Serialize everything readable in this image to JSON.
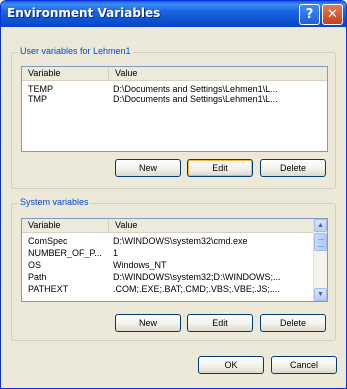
{
  "window": {
    "title": "Environment Variables",
    "help_glyph": "?",
    "close_glyph": "✕"
  },
  "user_vars": {
    "legend": "User variables for Lehmen1",
    "columns": [
      "Variable",
      "Value"
    ],
    "rows": [
      {
        "variable": "TEMP",
        "value": "D:\\Documents and Settings\\Lehmen1\\L..."
      },
      {
        "variable": "TMP",
        "value": "D:\\Documents and Settings\\Lehmen1\\L..."
      }
    ],
    "buttons": {
      "new": "New",
      "edit": "Edit",
      "delete": "Delete"
    }
  },
  "system_vars": {
    "legend": "System variables",
    "columns": [
      "Variable",
      "Value"
    ],
    "rows": [
      {
        "variable": "ComSpec",
        "value": "D:\\WINDOWS\\system32\\cmd.exe"
      },
      {
        "variable": "NUMBER_OF_P...",
        "value": "1"
      },
      {
        "variable": "OS",
        "value": "Windows_NT"
      },
      {
        "variable": "Path",
        "value": "D:\\WINDOWS\\system32;D:\\WINDOWS;..."
      },
      {
        "variable": "PATHEXT",
        "value": ".COM;.EXE;.BAT;.CMD;.VBS;.VBE;.JS;...."
      }
    ],
    "buttons": {
      "new": "New",
      "edit": "Edit",
      "delete": "Delete"
    }
  },
  "footer": {
    "ok": "OK",
    "cancel": "Cancel"
  }
}
